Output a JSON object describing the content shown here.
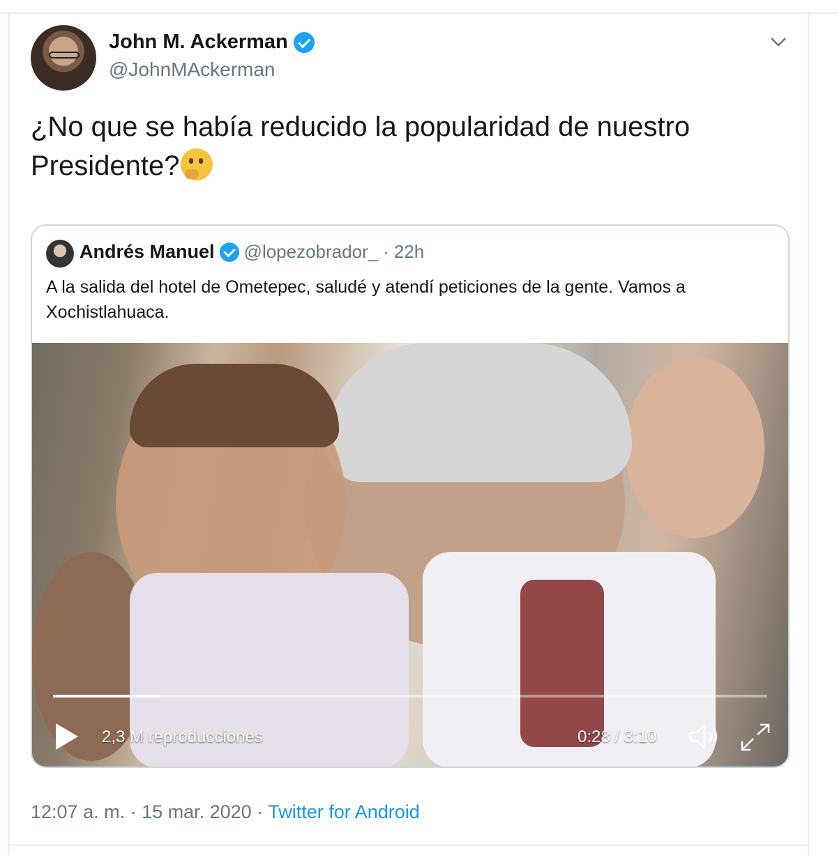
{
  "tweet": {
    "author_name": "John M. Ackerman",
    "author_handle": "@JohnMAckerman",
    "text": "¿No que se había reducido la popularidad de nuestro Presidente?",
    "emoji": "thinking-face-emoji",
    "timestamp": "12:07 a. m. · 15 mar. 2020 ·",
    "source": "Twitter for Android"
  },
  "quoted": {
    "author_name": "Andrés Manuel",
    "author_handle": "@lopezobrador_",
    "separator": "·",
    "time": "22h",
    "text": "A la salida del hotel de Ometepec, saludé y atendí peticiones de la gente. Vamos a Xochistlahuaca.",
    "video": {
      "views": "2,3 M reproducciones",
      "time": "0:28 / 3:10",
      "progress_fraction": 0.15
    }
  },
  "icons": {
    "menu": "chevron-down-icon",
    "verified": "verified-badge-icon",
    "play": "play-icon",
    "volume": "volume-icon",
    "fullscreen": "fullscreen-icon"
  },
  "colors": {
    "accent": "#1da1f2",
    "link": "#1b95e0",
    "secondary_text": "#657786",
    "border": "#ccd6dd"
  }
}
